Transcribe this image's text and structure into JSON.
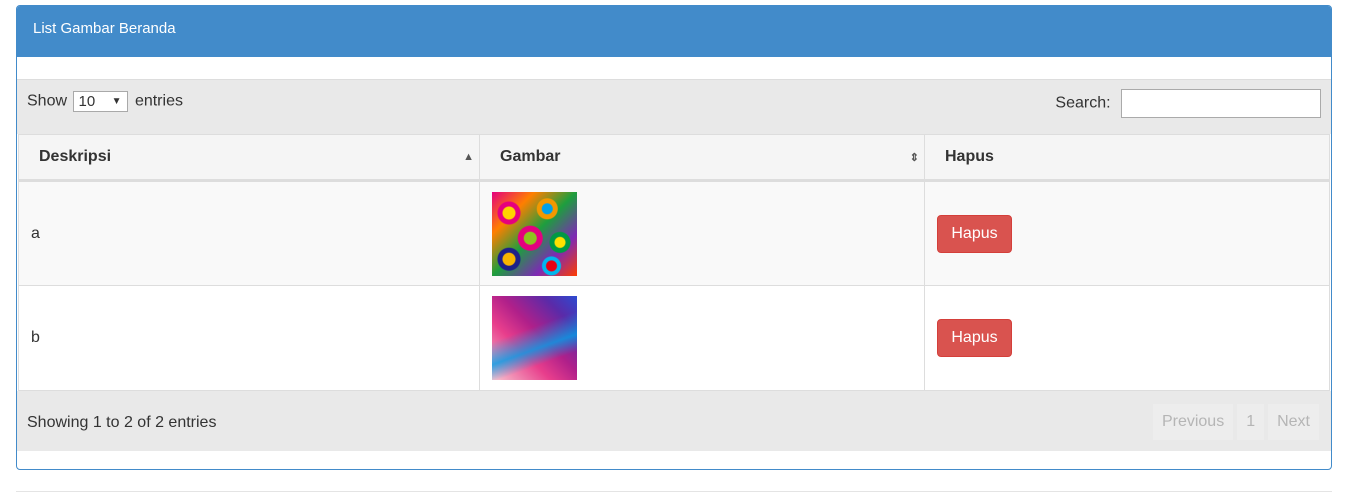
{
  "panel": {
    "title": "List Gambar Beranda"
  },
  "length": {
    "show_label": "Show",
    "selected": "10",
    "entries_label": "entries"
  },
  "search": {
    "label": "Search:",
    "value": ""
  },
  "table": {
    "headers": [
      "Deskripsi",
      "Gambar",
      "Hapus"
    ],
    "rows": [
      {
        "deskripsi": "a",
        "image": "colorful-flower-pattern",
        "action": "Hapus"
      },
      {
        "deskripsi": "b",
        "image": "abstract-polygon-gradient",
        "action": "Hapus"
      }
    ]
  },
  "footer": {
    "info": "Showing 1 to 2 of 2 entries",
    "pagination": {
      "previous": "Previous",
      "page": "1",
      "next": "Next"
    }
  },
  "colors": {
    "primary": "#428bca",
    "danger": "#d9534f",
    "toolbar": "#e9e9e9"
  },
  "icons": {
    "sort_asc": "sort-asc-icon",
    "sort_both": "sort-both-icon",
    "select_caret": "caret-down-icon"
  }
}
